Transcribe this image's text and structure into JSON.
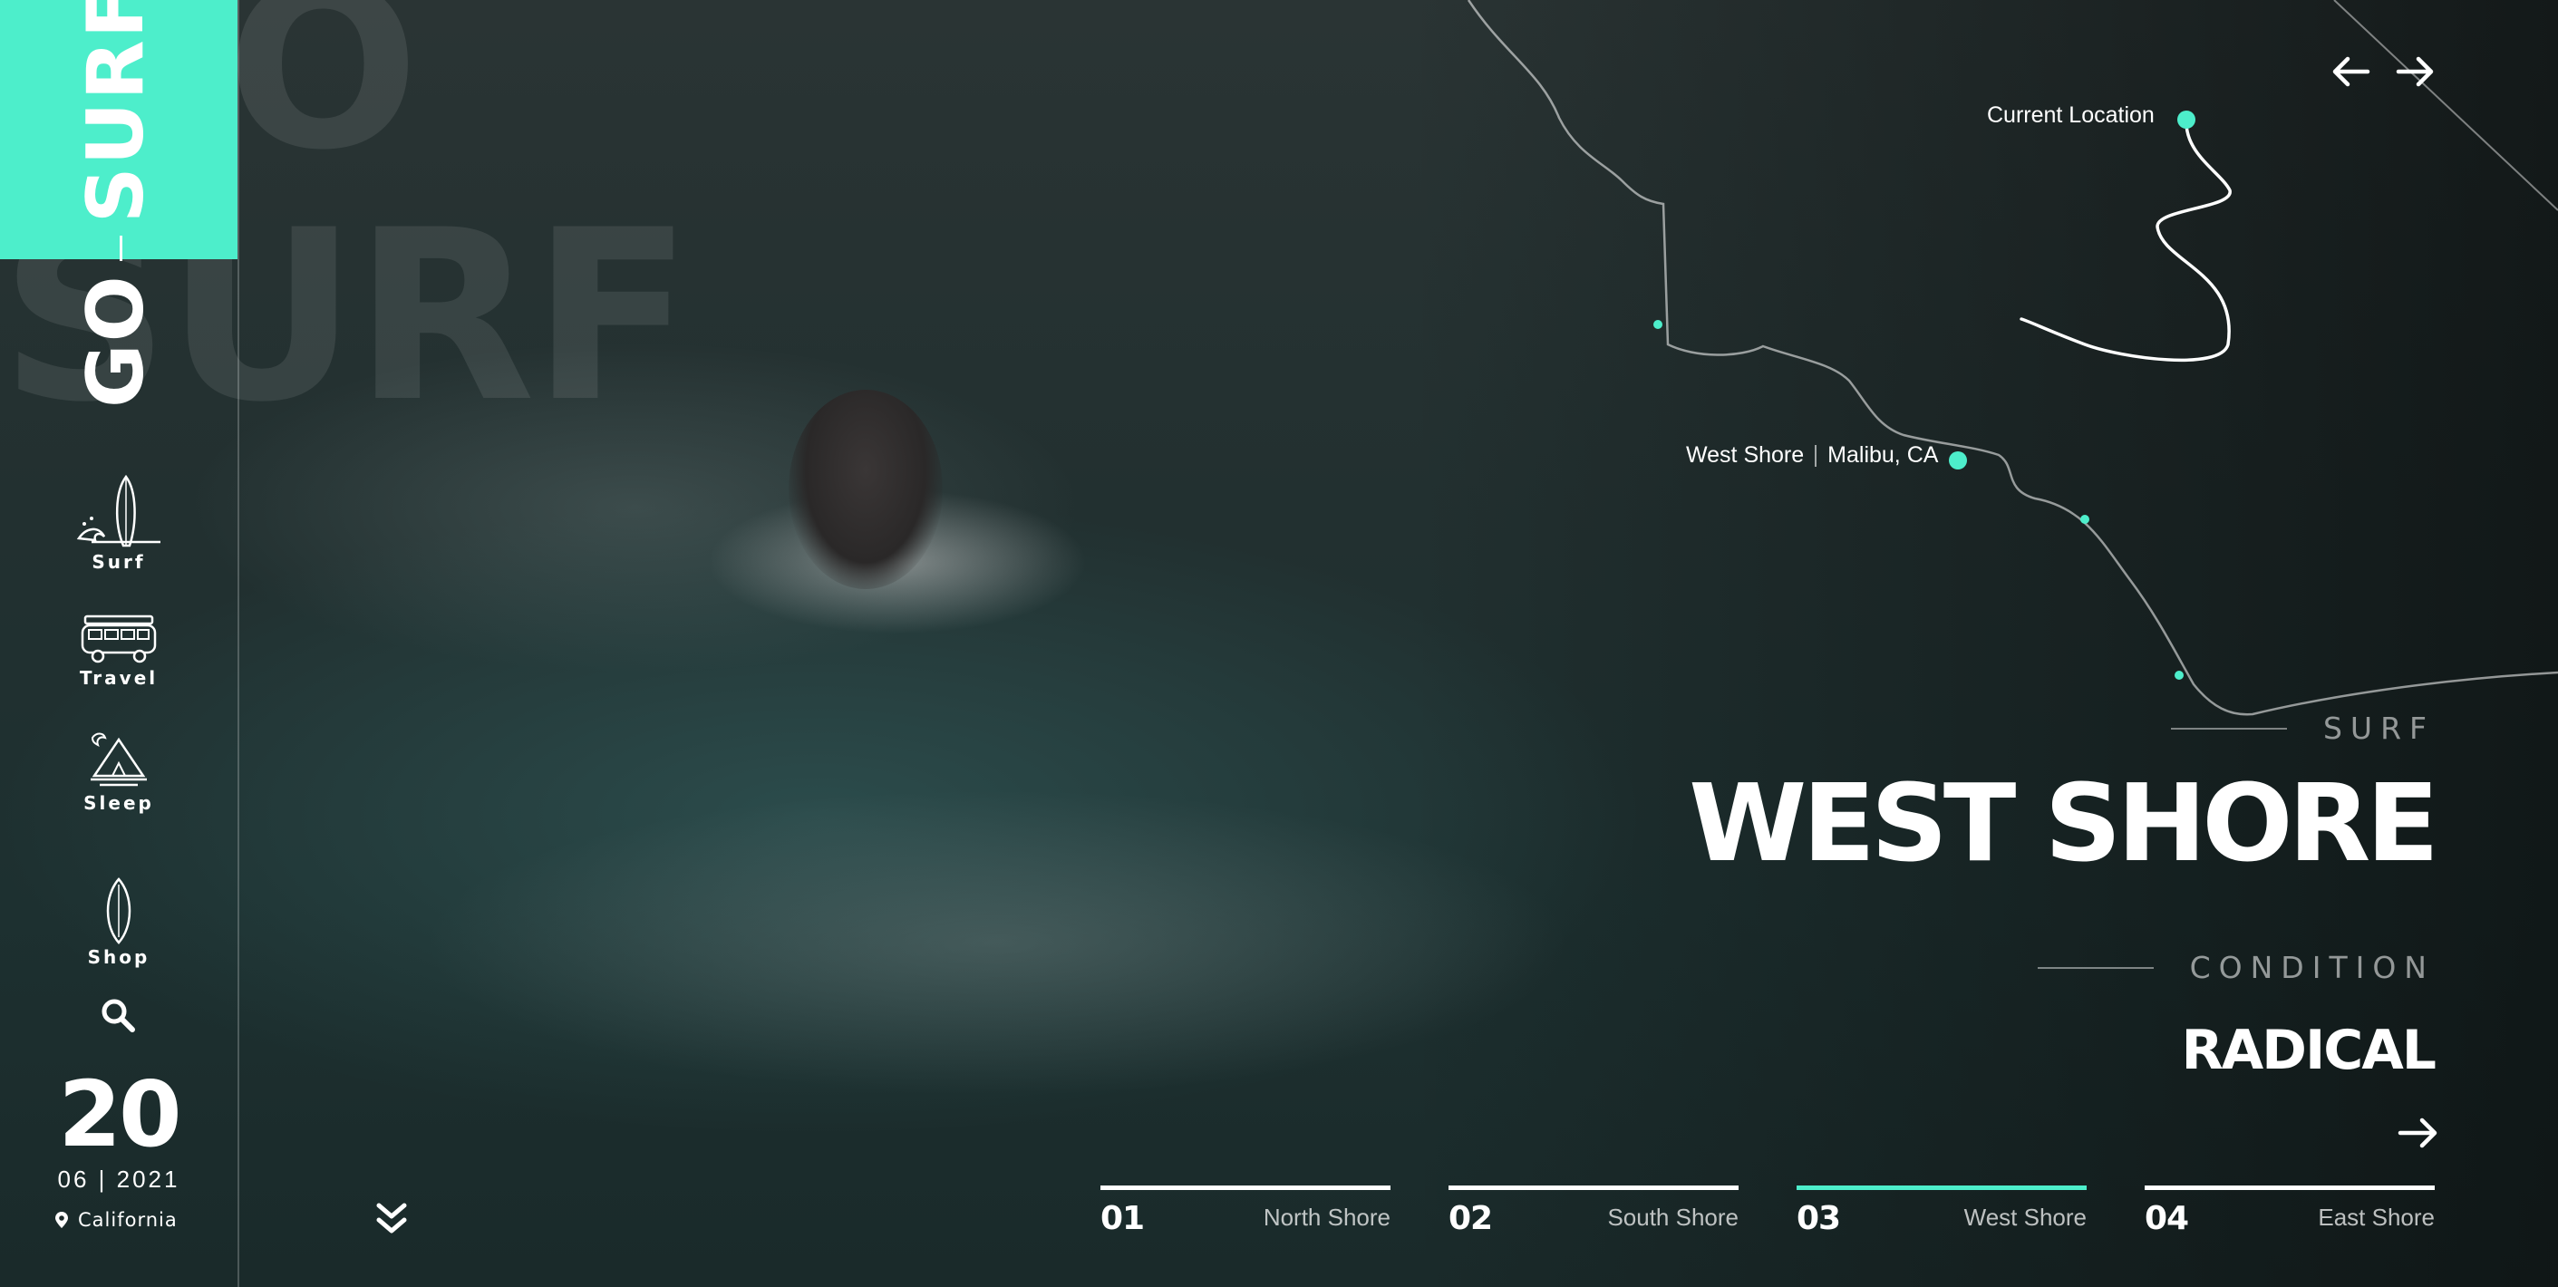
{
  "brand": {
    "logo_part1": "GO",
    "logo_part2": "SURF",
    "bg_word_top": "O",
    "bg_word": "SURF",
    "accent": "#4deecb"
  },
  "nav": [
    {
      "label": "Surf",
      "icon": "surfboard-wave-icon"
    },
    {
      "label": "Travel",
      "icon": "van-icon"
    },
    {
      "label": "Sleep",
      "icon": "tent-campfire-icon"
    },
    {
      "label": "Shop",
      "icon": "surfboard-icon"
    }
  ],
  "date": {
    "day": "20",
    "month_year": "06 | 2021"
  },
  "location": {
    "label": "California",
    "icon": "location-pin-icon"
  },
  "map": {
    "current_location": "Current Location",
    "spot_name": "West Shore",
    "spot_place": "Malibu, CA"
  },
  "hero": {
    "eyebrow": "SURF",
    "title": "WEST SHORE",
    "condition_label": "CONDITION",
    "condition_value": "RADICAL"
  },
  "tabs": [
    {
      "num": "01",
      "name": "North Shore",
      "active": false
    },
    {
      "num": "02",
      "name": "South Shore",
      "active": false
    },
    {
      "num": "03",
      "name": "West Shore",
      "active": true
    },
    {
      "num": "04",
      "name": "East Shore",
      "active": false
    }
  ]
}
